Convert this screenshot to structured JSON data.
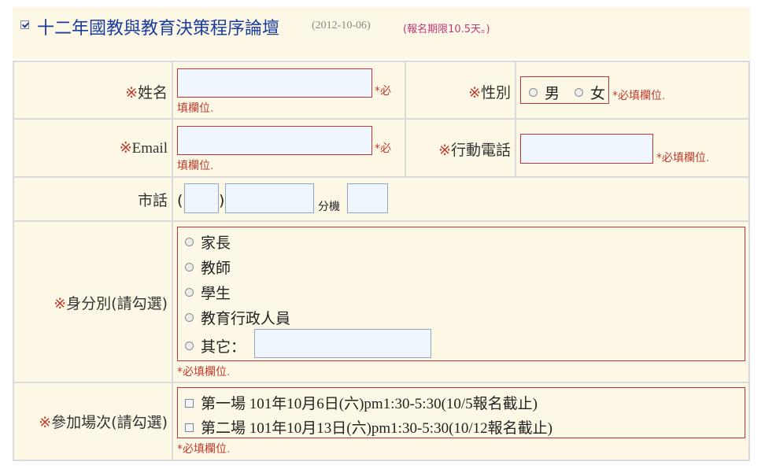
{
  "header": {
    "title": "十二年國教與教育決策程序論壇",
    "date": "(2012-10-06)",
    "limit": "(報名期限10.5天。)"
  },
  "form": {
    "required_mark": "※",
    "name_label": "姓名",
    "gender_label": "性別",
    "gender_options": [
      "男",
      "女"
    ],
    "email_label": "Email",
    "mobile_label": "行動電話",
    "phone_label": "市話",
    "phone_open": "(",
    "phone_close": ")",
    "ext_label": "分機",
    "identity_label": "身分別(請勾選)",
    "identity_options": [
      "家長",
      "教師",
      "學生",
      "教育行政人員",
      "其它："
    ],
    "session_label": "參加場次(請勾選)",
    "session_options": [
      "第一場 101年10月6日(六)pm1:30-5:30(10/5報名截止)",
      "第二場 101年10月13日(六)pm1:30-5:30(10/12報名截止)"
    ],
    "required_star": "*",
    "required_word": "必填欄位",
    "dot": ".",
    "required_part1": "必",
    "required_part2": "填欄位",
    "colors": {
      "required_red": "#c8323a",
      "title_blue": "#1a3c9c",
      "panel_bg": "#fdf8e6"
    }
  }
}
